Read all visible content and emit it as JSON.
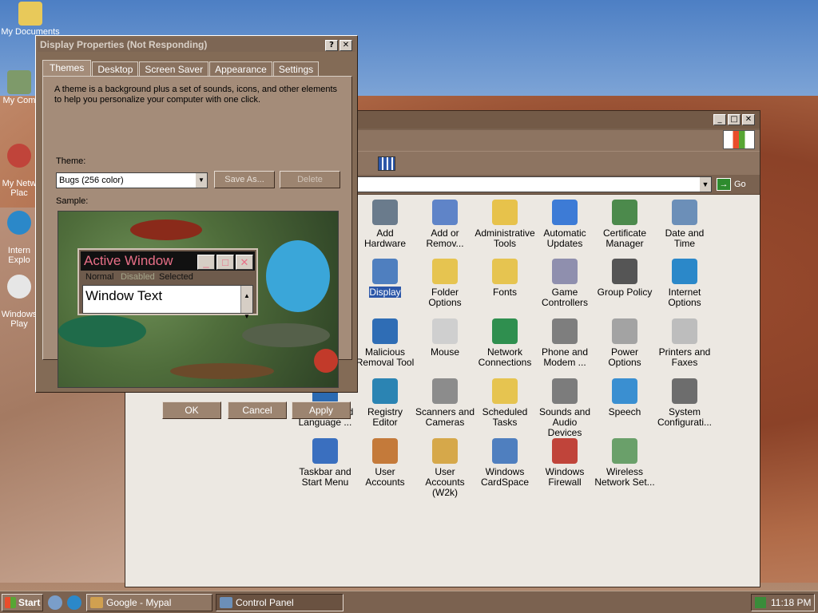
{
  "desktop": {
    "icons": [
      {
        "label": "My Documents"
      },
      {
        "label": "My Com"
      },
      {
        "label": "My Netw\nPlac"
      },
      {
        "label": "Intern\nExplo"
      },
      {
        "label": "Windows\nPlay"
      }
    ]
  },
  "control_panel": {
    "address_go": "Go",
    "items": [
      {
        "label": "Add Hardware",
        "icon": "add-hardware-icon",
        "color": "#6a7b8c"
      },
      {
        "label": "Add or Remov...",
        "icon": "add-remove-programs-icon",
        "color": "#5f84c8"
      },
      {
        "label": "Administrative Tools",
        "icon": "administrative-tools-icon",
        "color": "#e7c24b"
      },
      {
        "label": "Automatic Updates",
        "icon": "automatic-updates-icon",
        "color": "#3d7bd6"
      },
      {
        "label": "Certificate Manager",
        "icon": "certificate-icon",
        "color": "#4c8a4c"
      },
      {
        "label": "Date and Time",
        "icon": "clock-icon",
        "color": "#6c8fb8"
      },
      {
        "label": "Display",
        "icon": "display-icon",
        "color": "#4f7fbf",
        "selected": true
      },
      {
        "label": "Folder Options",
        "icon": "folder-options-icon",
        "color": "#e6c450"
      },
      {
        "label": "Fonts",
        "icon": "fonts-icon",
        "color": "#e6c450"
      },
      {
        "label": "Game Controllers",
        "icon": "game-controller-icon",
        "color": "#8f8fae"
      },
      {
        "label": "Group Policy",
        "icon": "group-policy-icon",
        "color": "#555"
      },
      {
        "label": "Internet Options",
        "icon": "internet-options-icon",
        "color": "#2b88c9"
      },
      {
        "label": "Malicious Removal Tool",
        "icon": "malicious-removal-icon",
        "color": "#2f6db5"
      },
      {
        "label": "Mouse",
        "icon": "mouse-icon",
        "color": "#cfcfcf"
      },
      {
        "label": "Network Connections",
        "icon": "network-icon",
        "color": "#2f8f4f"
      },
      {
        "label": "Phone and Modem ...",
        "icon": "phone-icon",
        "color": "#7e7e7e"
      },
      {
        "label": "Power Options",
        "icon": "power-icon",
        "color": "#a3a3a3"
      },
      {
        "label": "Printers and Faxes",
        "icon": "printer-icon",
        "color": "#bdbdbd"
      },
      {
        "label": "Regional and Language ...",
        "icon": "regional-icon",
        "color": "#2b6ab2"
      },
      {
        "label": "Registry Editor",
        "icon": "registry-icon",
        "color": "#2b84b3"
      },
      {
        "label": "Scanners and Cameras",
        "icon": "scanner-icon",
        "color": "#8c8c8c"
      },
      {
        "label": "Scheduled Tasks",
        "icon": "scheduled-tasks-icon",
        "color": "#e6c450"
      },
      {
        "label": "Sounds and Audio Devices",
        "icon": "speaker-icon",
        "color": "#7c7c7c"
      },
      {
        "label": "Speech",
        "icon": "speech-icon",
        "color": "#3a8fd1"
      },
      {
        "label": "System Configurati...",
        "icon": "system-config-icon",
        "color": "#6d6d6d"
      },
      {
        "label": "Taskbar and Start Menu",
        "icon": "taskbar-icon",
        "color": "#3a6fbf"
      },
      {
        "label": "User Accounts",
        "icon": "user-accounts-icon",
        "color": "#c47a3a"
      },
      {
        "label": "User Accounts (W2k)",
        "icon": "user-accounts-w2k-icon",
        "color": "#d6a84a"
      },
      {
        "label": "Windows CardSpace",
        "icon": "cardspace-icon",
        "color": "#4f7fbf"
      },
      {
        "label": "Windows Firewall",
        "icon": "firewall-icon",
        "color": "#c0443a"
      },
      {
        "label": "Wireless Network Set...",
        "icon": "wireless-icon",
        "color": "#6aa06a"
      }
    ]
  },
  "dialog": {
    "title": "Display Properties (Not Responding)",
    "tabs": [
      "Themes",
      "Desktop",
      "Screen Saver",
      "Appearance",
      "Settings"
    ],
    "description": "A theme is a background plus a set of sounds, icons, and other elements to help you personalize your computer with one click.",
    "theme_label": "Theme:",
    "theme_value": "Bugs (256 color)",
    "save_as": "Save As...",
    "delete": "Delete",
    "sample_label": "Sample:",
    "sample": {
      "window_title": "Active Window",
      "menu_normal": "Normal",
      "menu_disabled": "Disabled",
      "menu_selected": "Selected",
      "window_text": "Window Text"
    },
    "ok": "OK",
    "cancel": "Cancel",
    "apply": "Apply"
  },
  "taskbar": {
    "start": "Start",
    "tasks": [
      {
        "label": "Google - Mypal"
      },
      {
        "label": "Control Panel"
      }
    ],
    "clock": "11:18 PM"
  }
}
